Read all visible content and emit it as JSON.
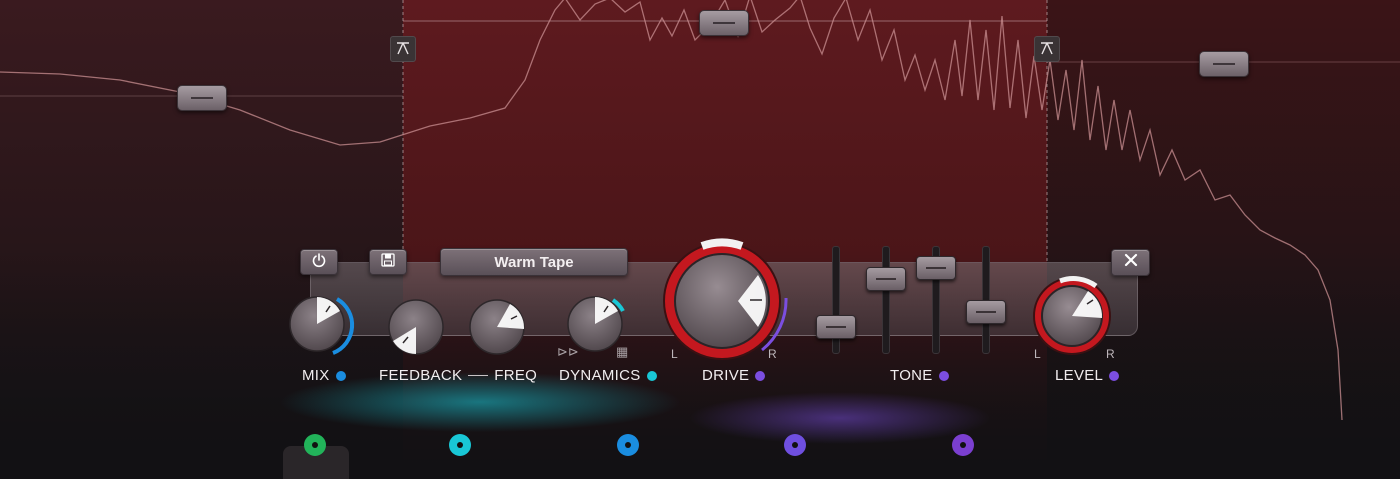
{
  "preset": {
    "name": "Warm Tape"
  },
  "controls": {
    "mix": {
      "label": "MIX",
      "color": "#1a8de0"
    },
    "feedback": {
      "label": "FEEDBACK"
    },
    "freq": {
      "label": "FREQ"
    },
    "dynamics": {
      "label": "DYNAMICS",
      "color": "#19c7d6"
    },
    "drive": {
      "label": "DRIVE",
      "color": "#7b4ee0",
      "left": "L",
      "right": "R"
    },
    "tone": {
      "label": "TONE",
      "color": "#7b4ee0"
    },
    "level": {
      "label": "LEVEL",
      "color": "#7b4ee0",
      "left": "L",
      "right": "R"
    }
  },
  "icons": {
    "power": "power-icon",
    "save": "save-icon",
    "close": "close-icon",
    "band_split": "band-split-icon"
  },
  "modulation_colors": [
    "#22b35a",
    "#19c7d6",
    "#1a8de0",
    "#6f4fe0",
    "#7b3fd0"
  ],
  "accent": {
    "red": "#c4181f",
    "cyan": "#19c7d6",
    "purple": "#7b4ee0"
  }
}
